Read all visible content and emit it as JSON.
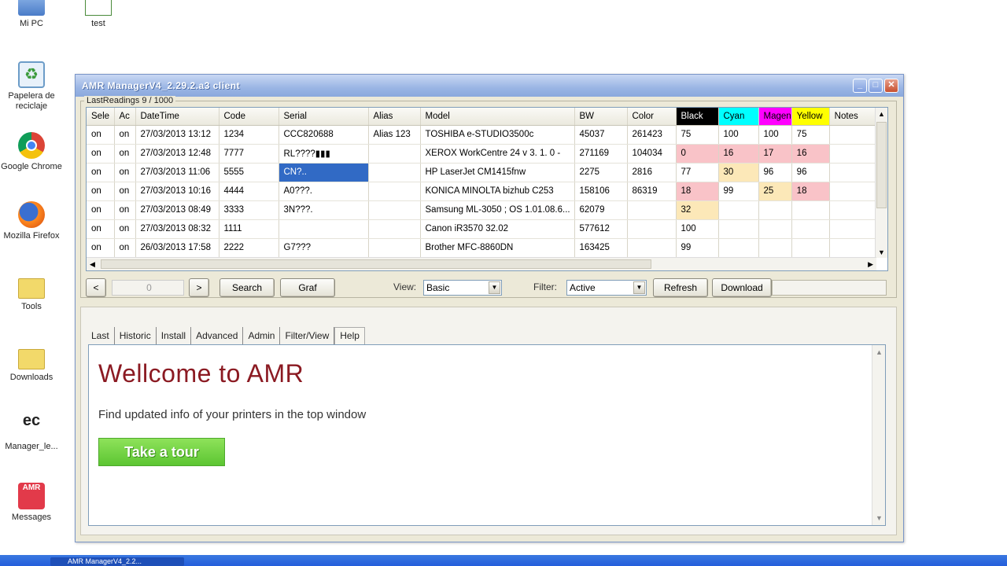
{
  "desktop": {
    "icons": [
      {
        "label": "Mi PC"
      },
      {
        "label": "test"
      },
      {
        "label": "Papelera de reciclaje"
      },
      {
        "label": "Google Chrome"
      },
      {
        "label": "Mozilla Firefox"
      },
      {
        "label": "Tools"
      },
      {
        "label": "Downloads"
      },
      {
        "label": "Manager_le..."
      },
      {
        "label": "Messages"
      }
    ]
  },
  "window": {
    "title": "AMR ManagerV4_2.29.2.a3  client",
    "controls": {
      "minimize": "_",
      "maximize": "□",
      "close": "✕"
    },
    "readings_label": "LastReadings 9 / 1000",
    "table": {
      "columns": [
        "Sele",
        "Ac",
        "DateTime",
        "Code",
        "Serial",
        "Alias",
        "Model",
        "BW",
        "Color",
        "Black",
        "Cyan",
        "Magen",
        "Yellow",
        "Notes"
      ],
      "rows": [
        [
          "on",
          "on",
          "27/03/2013 13:12",
          "1234",
          "CCC820688",
          "Alias 123",
          "TOSHIBA e-STUDIO3500c",
          "45037",
          "261423",
          "75",
          "100",
          "100",
          "75",
          ""
        ],
        [
          "on",
          "on",
          "27/03/2013 12:48",
          "7777",
          "RL????▮▮▮",
          "",
          "XEROX WorkCentre 24 v  3.  1.  0 -",
          "271169",
          "104034",
          "0",
          "16",
          "17",
          "16",
          ""
        ],
        [
          "on",
          "on",
          "27/03/2013 11:06",
          "5555",
          "CN?..",
          "",
          "HP LaserJet CM1415fnw",
          "2275",
          "2816",
          "77",
          "30",
          "96",
          "96",
          ""
        ],
        [
          "on",
          "on",
          "27/03/2013 10:16",
          "4444",
          "A0???.",
          "",
          "KONICA MINOLTA bizhub C253",
          "158106",
          "86319",
          "18",
          "99",
          "25",
          "18",
          ""
        ],
        [
          "on",
          "on",
          "27/03/2013 08:49",
          "3333",
          "3N???.",
          "",
          "Samsung ML-3050 ; OS 1.01.08.6...",
          "62079",
          "",
          "32",
          "",
          "",
          "",
          ""
        ],
        [
          "on",
          "on",
          "27/03/2013 08:32",
          "1111",
          "",
          "",
          "Canon iR3570 32.02",
          "577612",
          "",
          "100",
          "",
          "",
          "",
          ""
        ],
        [
          "on",
          "on",
          "26/03/2013 17:58",
          "2222",
          "G7???",
          "",
          "Brother MFC-8860DN",
          "163425",
          "",
          "99",
          "",
          "",
          "",
          ""
        ]
      ]
    },
    "toolbar": {
      "prev": "<",
      "page": "0",
      "next": ">",
      "search_label": "Search",
      "graf_label": "Graf",
      "view_label": "View:",
      "view_value": "Basic",
      "filter_label": "Filter:",
      "filter_value": "Active",
      "refresh_label": "Refresh",
      "download_label": "Download"
    },
    "tabs": [
      "Last",
      "Historic",
      "Install",
      "Advanced",
      "Admin",
      "Filter/View",
      "Help"
    ],
    "active_tab": "Help",
    "help": {
      "heading": "Wellcome to AMR",
      "text": "Find updated info of your printers in the top window",
      "tour_button": "Take a tour"
    }
  },
  "taskbar": {
    "item_label": "AMR ManagerV4_2.2..."
  },
  "colors": {
    "black_header": "#000000",
    "cyan_header": "#00ffff",
    "magenta_header": "#ff00ff",
    "yellow_header": "#ffff00",
    "low_level": "#f9c3c8",
    "mid_level": "#fce8b8",
    "selected": "#316ac5",
    "heading": "#8b1a22",
    "tour": "#6fd040"
  }
}
